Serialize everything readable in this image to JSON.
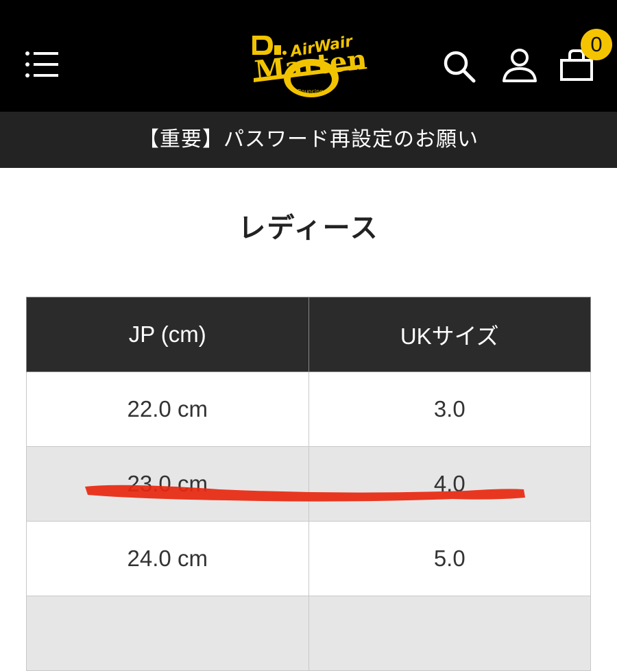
{
  "header": {
    "logo_text": "Dr. Martens AirWair With Bouncing Soles",
    "cart_count": "0",
    "icons": [
      "menu-icon",
      "search-icon",
      "account-icon",
      "cart-icon"
    ]
  },
  "notice": {
    "text": "【重要】パスワード再設定のお願い"
  },
  "section": {
    "title": "レディース"
  },
  "size_table": {
    "headers": [
      "JP (cm)",
      "UKサイズ"
    ],
    "rows": [
      [
        "22.0 cm",
        "3.0"
      ],
      [
        "23.0 cm",
        "4.0"
      ],
      [
        "24.0 cm",
        "5.0"
      ],
      [
        "",
        ""
      ]
    ]
  },
  "colors": {
    "header_bg": "#000000",
    "notice_bg": "#232323",
    "badge": "#f5c400",
    "logo_yellow": "#f2c400",
    "strike_red": "#e8280f"
  }
}
